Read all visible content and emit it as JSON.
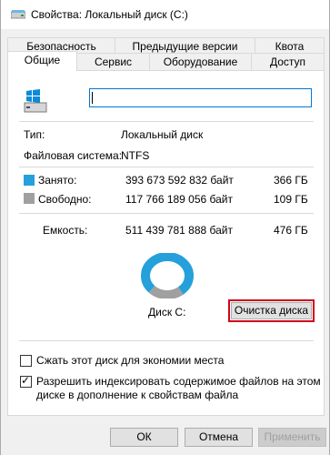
{
  "window": {
    "title": "Свойства: Локальный диск (C:)"
  },
  "tabs": {
    "row1": [
      "Безопасность",
      "Предыдущие версии",
      "Квота"
    ],
    "row2": [
      "Общие",
      "Сервис",
      "Оборудование",
      "Доступ"
    ]
  },
  "general": {
    "drive_name_value": "",
    "type_label": "Тип:",
    "type_value": "Локальный диск",
    "fs_label": "Файловая система:",
    "fs_value": "NTFS",
    "used_label": "Занято:",
    "used_bytes": "393 673 592 832 байт",
    "used_size": "366 ГБ",
    "free_label": "Свободно:",
    "free_bytes": "117 766 189 056 байт",
    "free_size": "109 ГБ",
    "capacity_label": "Емкость:",
    "capacity_bytes": "511 439 781 888 байт",
    "capacity_size": "476 ГБ",
    "disk_label": "Диск C:",
    "cleanup_button": "Очистка диска",
    "compress_label": "Сжать этот диск для экономии места",
    "compress_checked": false,
    "index_label_line1": "Разрешить индексировать содержимое файлов на этом",
    "index_label_line2": "диске в дополнение к свойствам файла",
    "index_checked": true,
    "used_fraction": 0.7697,
    "colors": {
      "used": "#26a0da",
      "free": "#a0a0a0"
    }
  },
  "buttons": {
    "ok": "ОК",
    "cancel": "Отмена",
    "apply": "Применить"
  }
}
